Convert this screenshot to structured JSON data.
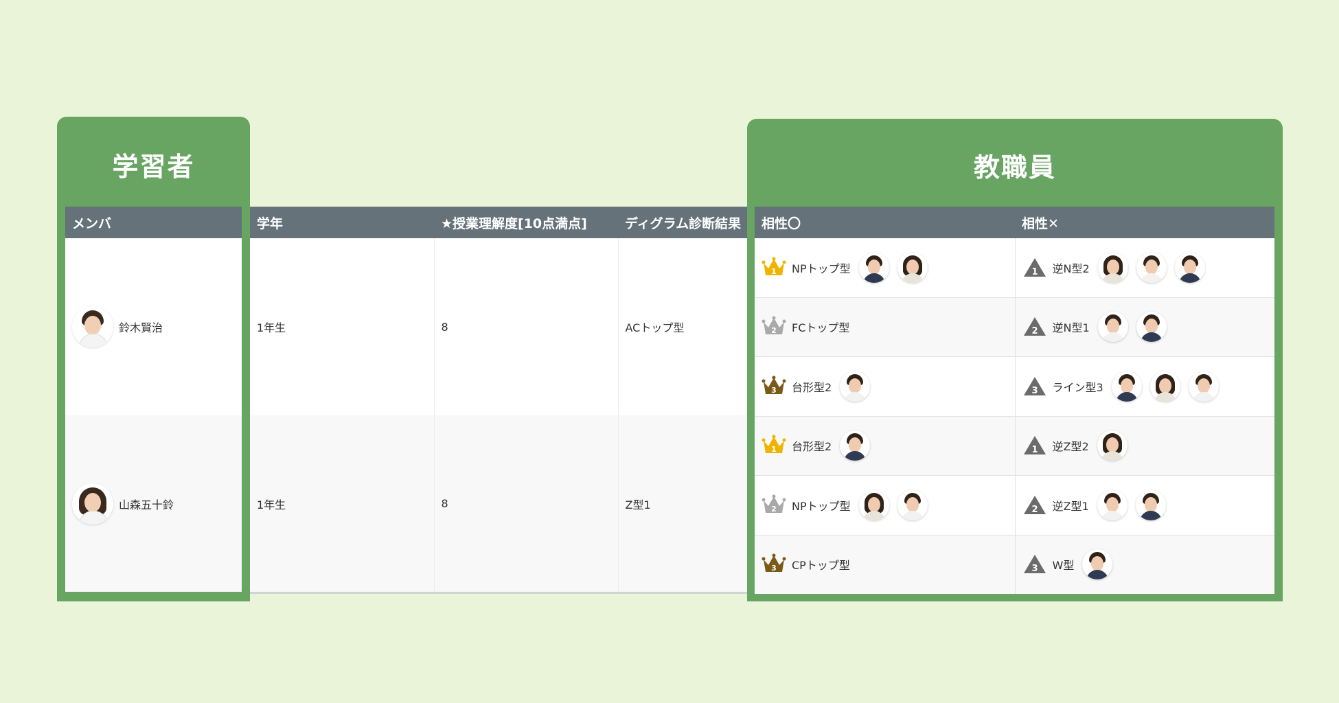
{
  "learner_panel": {
    "title": "学習者",
    "header": "メンバ"
  },
  "staff_panel": {
    "title": "教職員",
    "headers": [
      "相性〇",
      "相性✕"
    ]
  },
  "middle_headers": [
    "学年",
    "★授業理解度[10点満点]",
    "ディグラム診断結果"
  ],
  "members": [
    {
      "name": "鈴木賢治",
      "grade": "1年生",
      "score": "8",
      "result": "ACトップ型"
    },
    {
      "name": "山森五十鈴",
      "grade": "1年生",
      "score": "8",
      "result": "Z型1"
    }
  ],
  "compat_rows": [
    {
      "good": {
        "rank": "1",
        "type": "NPトップ型",
        "people": 2
      },
      "bad": {
        "rank": "1",
        "type": "逆N型2",
        "people": 3
      }
    },
    {
      "good": {
        "rank": "2",
        "type": "FCトップ型",
        "people": 0
      },
      "bad": {
        "rank": "2",
        "type": "逆N型1",
        "people": 2
      }
    },
    {
      "good": {
        "rank": "3",
        "type": "台形型2",
        "people": 1
      },
      "bad": {
        "rank": "3",
        "type": "ライン型3",
        "people": 3
      }
    },
    {
      "good": {
        "rank": "1",
        "type": "台形型2",
        "people": 1
      },
      "bad": {
        "rank": "1",
        "type": "逆Z型2",
        "people": 1
      }
    },
    {
      "good": {
        "rank": "2",
        "type": "NPトップ型",
        "people": 2
      },
      "bad": {
        "rank": "2",
        "type": "逆Z型1",
        "people": 2
      }
    },
    {
      "good": {
        "rank": "3",
        "type": "CPトップ型",
        "people": 0
      },
      "bad": {
        "rank": "3",
        "type": "W型",
        "people": 1
      }
    }
  ],
  "colors": {
    "gold": "#f0b400",
    "silver": "#a9a9a9",
    "bronze": "#7a5a17",
    "triangle": "#6b6b6b"
  }
}
